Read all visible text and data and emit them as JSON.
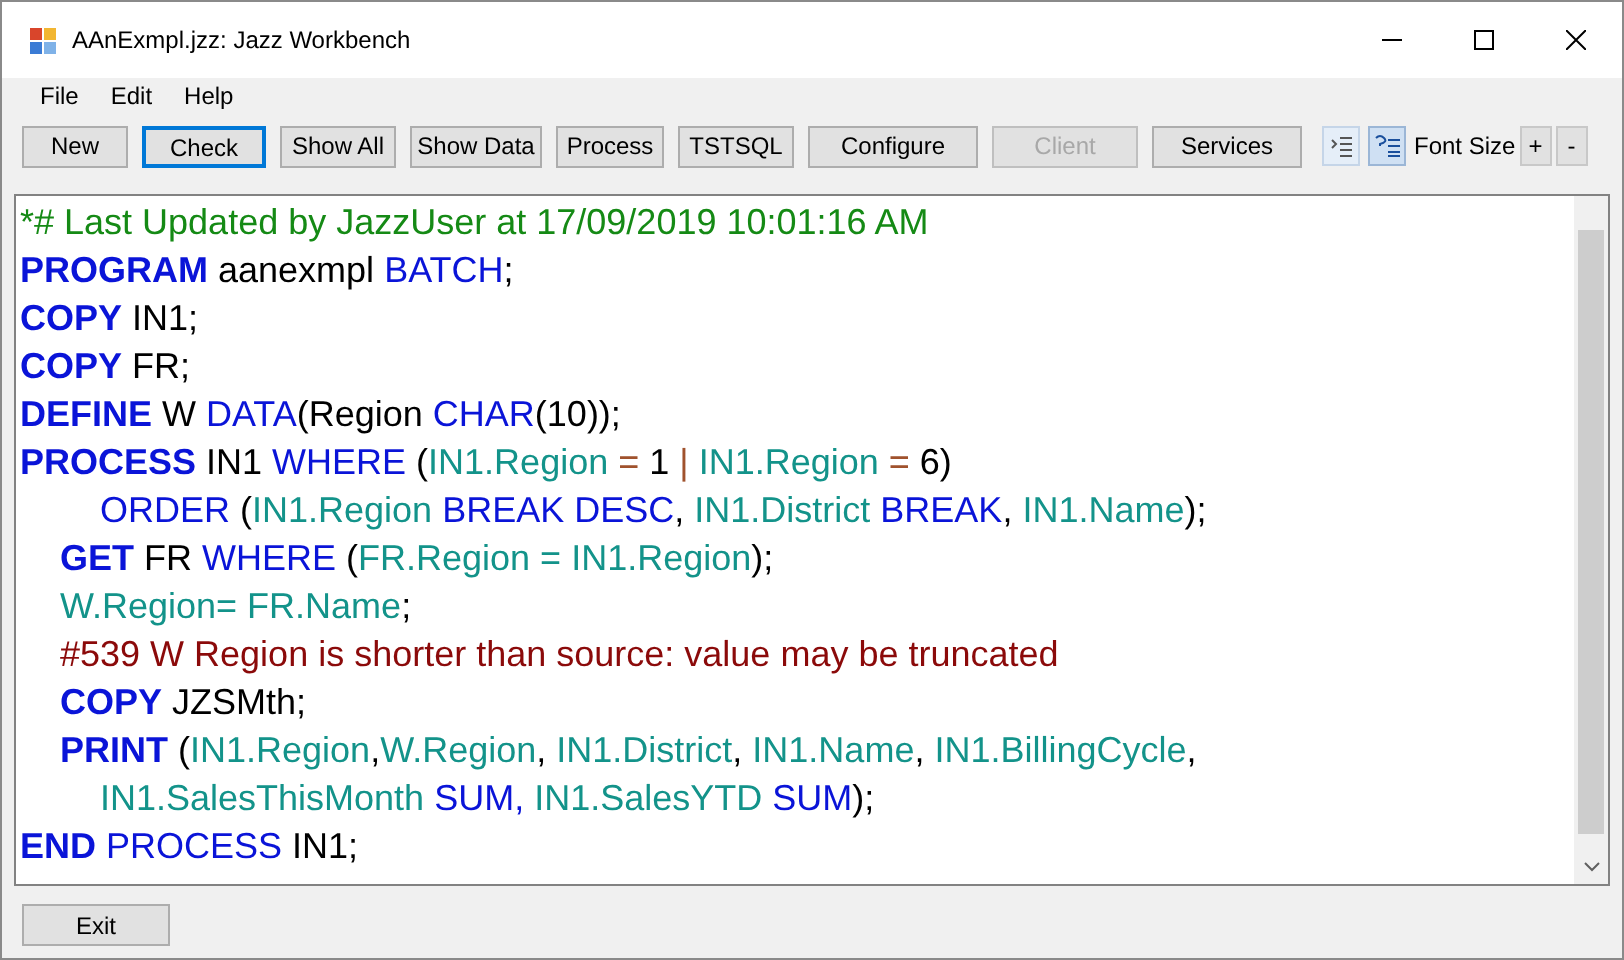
{
  "window": {
    "title": "AAnExmpl.jzz: Jazz Workbench"
  },
  "menu": [
    "File",
    "Edit",
    "Help"
  ],
  "toolbar": {
    "buttons": [
      {
        "label": "New",
        "disabled": false,
        "focused": false
      },
      {
        "label": "Check",
        "disabled": false,
        "focused": true
      },
      {
        "label": "Show All",
        "disabled": false,
        "focused": false
      },
      {
        "label": "Show Data",
        "disabled": false,
        "focused": false
      },
      {
        "label": "Process",
        "disabled": false,
        "focused": false
      },
      {
        "label": "TSTSQL",
        "disabled": false,
        "focused": false
      },
      {
        "label": "Configure",
        "disabled": false,
        "focused": false
      },
      {
        "label": "Client",
        "disabled": true,
        "focused": false
      },
      {
        "label": "Services",
        "disabled": false,
        "focused": false
      }
    ],
    "font_size_label": "Font Size",
    "font_size_buttons": [
      "+",
      "-"
    ]
  },
  "editor": {
    "lines": [
      {
        "kind": "top",
        "tokens": [
          {
            "kind": "comment",
            "text": "*# Last Updated by JazzUser at 17/09/2019 10:01:16 AM"
          }
        ]
      },
      {
        "kind": "top",
        "tokens": [
          {
            "kind": "kw",
            "text": "PROGRAM"
          },
          {
            "kind": "text",
            "text": " aanexmpl "
          },
          {
            "kind": "word",
            "text": "BATCH"
          },
          {
            "kind": "text",
            "text": ";"
          }
        ]
      },
      {
        "kind": "top",
        "tokens": [
          {
            "kind": "kw",
            "text": "COPY"
          },
          {
            "kind": "text",
            "text": " IN1;"
          }
        ]
      },
      {
        "kind": "top",
        "tokens": [
          {
            "kind": "kw",
            "text": "COPY"
          },
          {
            "kind": "text",
            "text": " FR;"
          }
        ]
      },
      {
        "kind": "top",
        "tokens": [
          {
            "kind": "kw",
            "text": "DEFINE"
          },
          {
            "kind": "text",
            "text": " W "
          },
          {
            "kind": "word",
            "text": "DATA"
          },
          {
            "kind": "text",
            "text": "(Region "
          },
          {
            "kind": "word",
            "text": "CHAR"
          },
          {
            "kind": "text",
            "text": "(10));"
          }
        ]
      },
      {
        "kind": "top",
        "tokens": [
          {
            "kind": "kw",
            "text": "PROCESS"
          },
          {
            "kind": "text",
            "text": " IN1 "
          },
          {
            "kind": "word",
            "text": "WHERE"
          },
          {
            "kind": "text",
            "text": " ("
          },
          {
            "kind": "field",
            "text": "IN1.Region"
          },
          {
            "kind": "op",
            "text": " = "
          },
          {
            "kind": "text",
            "text": "1 "
          },
          {
            "kind": "op",
            "text": "|"
          },
          {
            "kind": "field",
            "text": " IN1.Region"
          },
          {
            "kind": "op",
            "text": " = "
          },
          {
            "kind": "text",
            "text": "6)"
          }
        ]
      },
      {
        "kind": "wrap",
        "tokens": [
          {
            "kind": "word",
            "text": "ORDER"
          },
          {
            "kind": "text",
            "text": " ("
          },
          {
            "kind": "field",
            "text": "IN1.Region"
          },
          {
            "kind": "word",
            "text": " BREAK DESC"
          },
          {
            "kind": "text",
            "text": ", "
          },
          {
            "kind": "field",
            "text": "IN1.District"
          },
          {
            "kind": "word",
            "text": " BREAK"
          },
          {
            "kind": "text",
            "text": ", "
          },
          {
            "kind": "field",
            "text": "IN1.Name"
          },
          {
            "kind": "text",
            "text": ");"
          }
        ]
      },
      {
        "kind": "inner",
        "tokens": [
          {
            "kind": "kw",
            "text": "GET"
          },
          {
            "kind": "text",
            "text": " FR "
          },
          {
            "kind": "word",
            "text": "WHERE"
          },
          {
            "kind": "text",
            "text": " ("
          },
          {
            "kind": "field",
            "text": "FR.Region = IN1.Region"
          },
          {
            "kind": "text",
            "text": ");"
          }
        ]
      },
      {
        "kind": "inner",
        "tokens": [
          {
            "kind": "field",
            "text": "W.Region= FR.Name"
          },
          {
            "kind": "text",
            "text": ";"
          }
        ]
      },
      {
        "kind": "inner",
        "tokens": [
          {
            "kind": "error",
            "text": "#539 W Region is shorter than source: value may be truncated"
          }
        ]
      },
      {
        "kind": "inner",
        "tokens": [
          {
            "kind": "kw",
            "text": "COPY"
          },
          {
            "kind": "text",
            "text": " JZSMth;"
          }
        ]
      },
      {
        "kind": "inner",
        "tokens": [
          {
            "kind": "kw",
            "text": "PRINT"
          },
          {
            "kind": "text",
            "text": " ("
          },
          {
            "kind": "field",
            "text": "IN1.Region"
          },
          {
            "kind": "text",
            "text": ","
          },
          {
            "kind": "field",
            "text": "W.Region"
          },
          {
            "kind": "text",
            "text": ", "
          },
          {
            "kind": "field",
            "text": "IN1.District"
          },
          {
            "kind": "text",
            "text": ", "
          },
          {
            "kind": "field",
            "text": "IN1.Name"
          },
          {
            "kind": "text",
            "text": ", "
          },
          {
            "kind": "field",
            "text": "IN1.BillingCycle"
          },
          {
            "kind": "text",
            "text": ","
          }
        ]
      },
      {
        "kind": "wrap",
        "tokens": [
          {
            "kind": "field",
            "text": "IN1.SalesThisMonth"
          },
          {
            "kind": "word",
            "text": " SUM,"
          },
          {
            "kind": "field",
            "text": " IN1.SalesYTD"
          },
          {
            "kind": "word",
            "text": " SUM"
          },
          {
            "kind": "text",
            "text": ");"
          }
        ]
      },
      {
        "kind": "top",
        "tokens": [
          {
            "kind": "kw",
            "text": "END"
          },
          {
            "kind": "word",
            "text": " PROCESS"
          },
          {
            "kind": "text",
            "text": " IN1;"
          }
        ]
      }
    ]
  },
  "footer": {
    "button": "Exit"
  }
}
